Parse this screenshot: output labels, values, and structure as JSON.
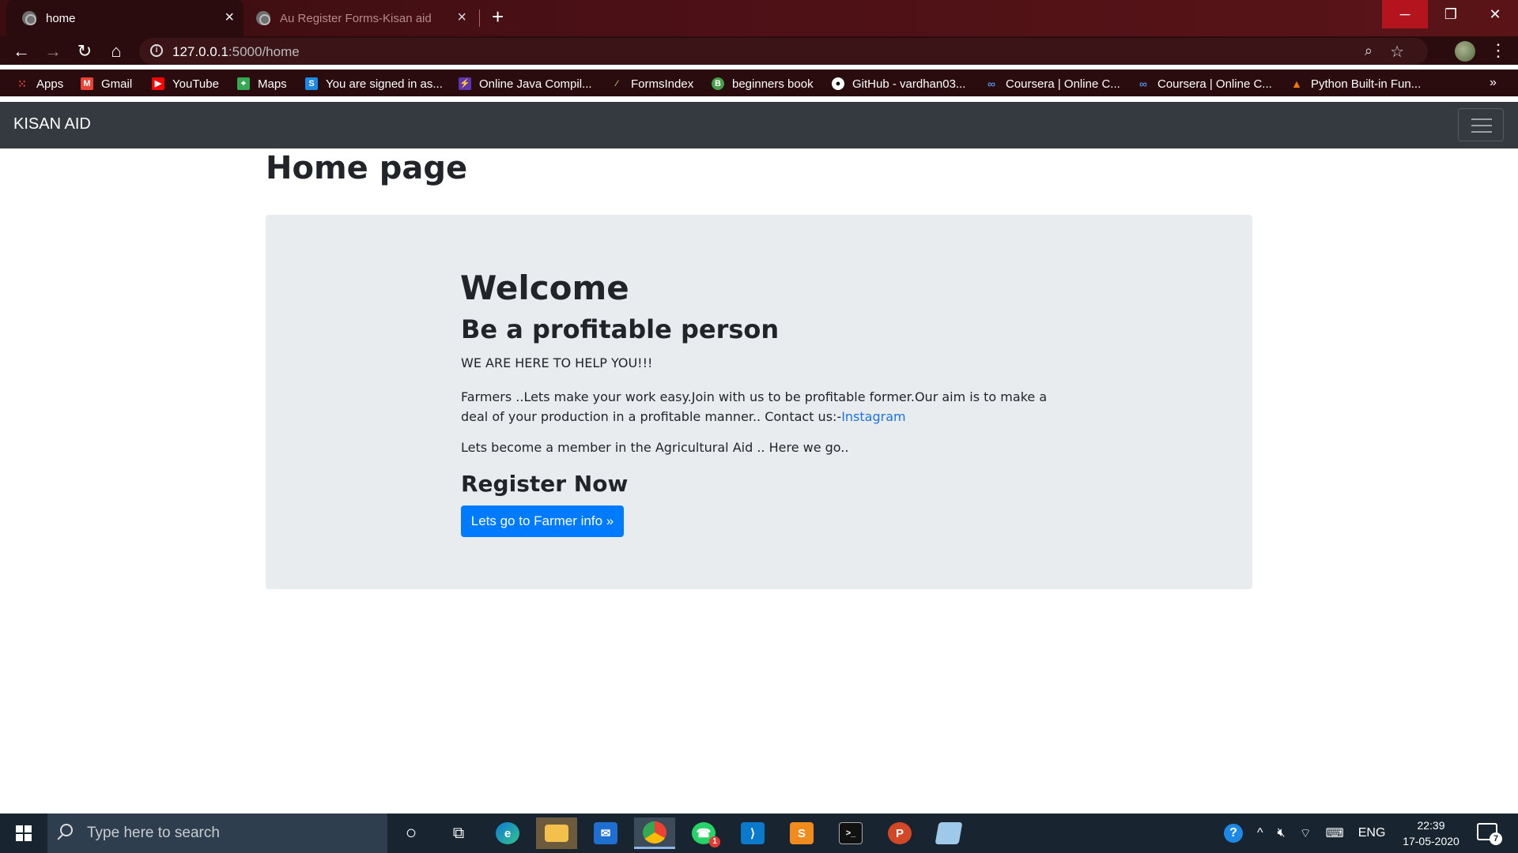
{
  "browser": {
    "tabs": [
      {
        "title": "home",
        "active": true
      },
      {
        "title": "Au Register Forms-Kisan aid",
        "active": false
      }
    ],
    "new_tab_icon": "plus-icon",
    "window_controls": {
      "minimize": "─",
      "maximize": "❐",
      "close": "✕"
    },
    "nav_icons": {
      "back": "←",
      "forward": "→",
      "reload": "↻",
      "home": "⌂"
    },
    "url_host": "127.0.0.1",
    "url_path": ":5000/home",
    "bookmarks": [
      {
        "label": "Apps",
        "icon": "apps-grid-icon",
        "color": "#e8453c"
      },
      {
        "label": "Gmail",
        "icon": "gmail-icon",
        "color": "#ea4335"
      },
      {
        "label": "YouTube",
        "icon": "youtube-icon",
        "color": "#ff0000"
      },
      {
        "label": "Maps",
        "icon": "maps-icon",
        "color": "#34a853"
      },
      {
        "label": "You are signed in as...",
        "icon": "s-icon",
        "color": "#1e88e5"
      },
      {
        "label": "Online Java Compil...",
        "icon": "bolt-icon",
        "color": "#5e35b1"
      },
      {
        "label": "FormsIndex",
        "icon": "forms-icon",
        "color": "#7cb342"
      },
      {
        "label": "beginners book",
        "icon": "b-icon",
        "color": "#43a047"
      },
      {
        "label": "GitHub - vardhan03...",
        "icon": "github-icon",
        "color": "#ffffff"
      },
      {
        "label": "Coursera | Online C...",
        "icon": "coursera-icon",
        "color": "#4a90e2"
      },
      {
        "label": "Coursera | Online C...",
        "icon": "coursera-icon",
        "color": "#4a90e2"
      },
      {
        "label": "Python Built-in Fun...",
        "icon": "cone-icon",
        "color": "#f57c00"
      }
    ],
    "bookmarks_more": "»"
  },
  "page": {
    "brand": "KISAN AID",
    "title": "Home page",
    "jumbotron": {
      "heading": "Welcome",
      "subheading": "Be a profitable person",
      "help_text": "WE ARE HERE TO HELP YOU!!!",
      "intro_text": "Farmers ..Lets make your work easy.Join with us to be profitable former.Our aim is to make a deal of your production in a profitable manner.. Contact us:-",
      "contact_link": "Instagram",
      "member_text": "Lets become a member in the Agricultural Aid .. Here we go..",
      "register_heading": "Register Now",
      "cta_label": "Lets go to Farmer info »"
    },
    "colors": {
      "navbar": "#343a40",
      "jumbotron": "#e9ecef",
      "primary": "#007bff"
    }
  },
  "taskbar": {
    "search_placeholder": "Type here to search",
    "apps": [
      "cortana-icon",
      "task-view-icon",
      "edge-icon",
      "file-explorer-icon",
      "mail-icon",
      "chrome-icon",
      "whatsapp-icon",
      "vscode-icon",
      "sublime-icon",
      "terminal-icon",
      "powerpoint-icon",
      "notepad-icon"
    ],
    "whatsapp_badge": "1",
    "language": "ENG",
    "time": "22:39",
    "date": "17-05-2020",
    "notification_count": "7"
  }
}
